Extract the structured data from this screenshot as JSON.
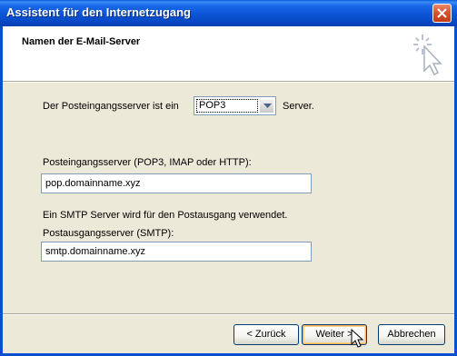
{
  "window": {
    "title": "Assistent für den Internetzugang"
  },
  "header": {
    "heading": "Namen der E-Mail-Server"
  },
  "form": {
    "incoming_type_prefix": "Der Posteingangsserver ist ein",
    "incoming_type_value": "POP3",
    "incoming_type_suffix": "Server.",
    "incoming_label": "Posteingangsserver (POP3, IMAP oder HTTP):",
    "incoming_value": "pop.domainname.xyz",
    "smtp_note": "Ein SMTP Server wird für den Postausgang verwendet.",
    "outgoing_label": "Postausgangsserver (SMTP):",
    "outgoing_value": "smtp.domainname.xyz"
  },
  "buttons": {
    "back": "< Zurück",
    "next": "Weiter >",
    "cancel": "Abbrechen"
  },
  "colors": {
    "titlebar": "#0b55d5",
    "background": "#ece9d8",
    "close": "#d8502c"
  },
  "icons": [
    "close-icon",
    "wizard-wand-icon",
    "dropdown-arrow-icon",
    "mouse-cursor-icon"
  ]
}
